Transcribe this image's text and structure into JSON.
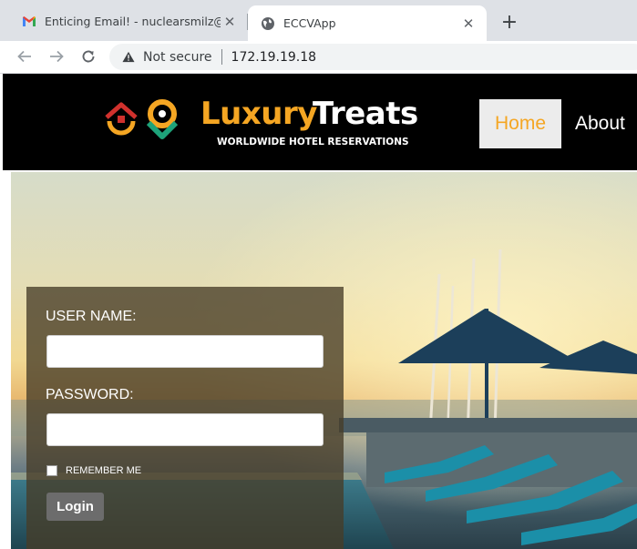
{
  "browser": {
    "tabs": [
      {
        "title": "Enticing Email! - nuclearsmilz@g",
        "favicon": "gmail-icon",
        "active": false
      },
      {
        "title": "ECCVApp",
        "favicon": "globe-icon",
        "active": true
      }
    ],
    "new_tab_symbol": "+",
    "close_symbol": "✕",
    "security_label": "Not secure",
    "url": "172.19.19.18"
  },
  "site": {
    "brand_part1": "Luxury",
    "brand_part2": "Treats",
    "tagline": "WORLDWIDE HOTEL RESERVATIONS",
    "nav": [
      {
        "label": "Home",
        "active": true
      },
      {
        "label": "About",
        "active": false
      }
    ],
    "accent_color": "#f5a623"
  },
  "login": {
    "username_label": "USER NAME:",
    "username_value": "",
    "password_label": "PASSWORD:",
    "password_value": "",
    "remember_label": "REMEMBER ME",
    "remember_checked": false,
    "button_label": "Login"
  }
}
